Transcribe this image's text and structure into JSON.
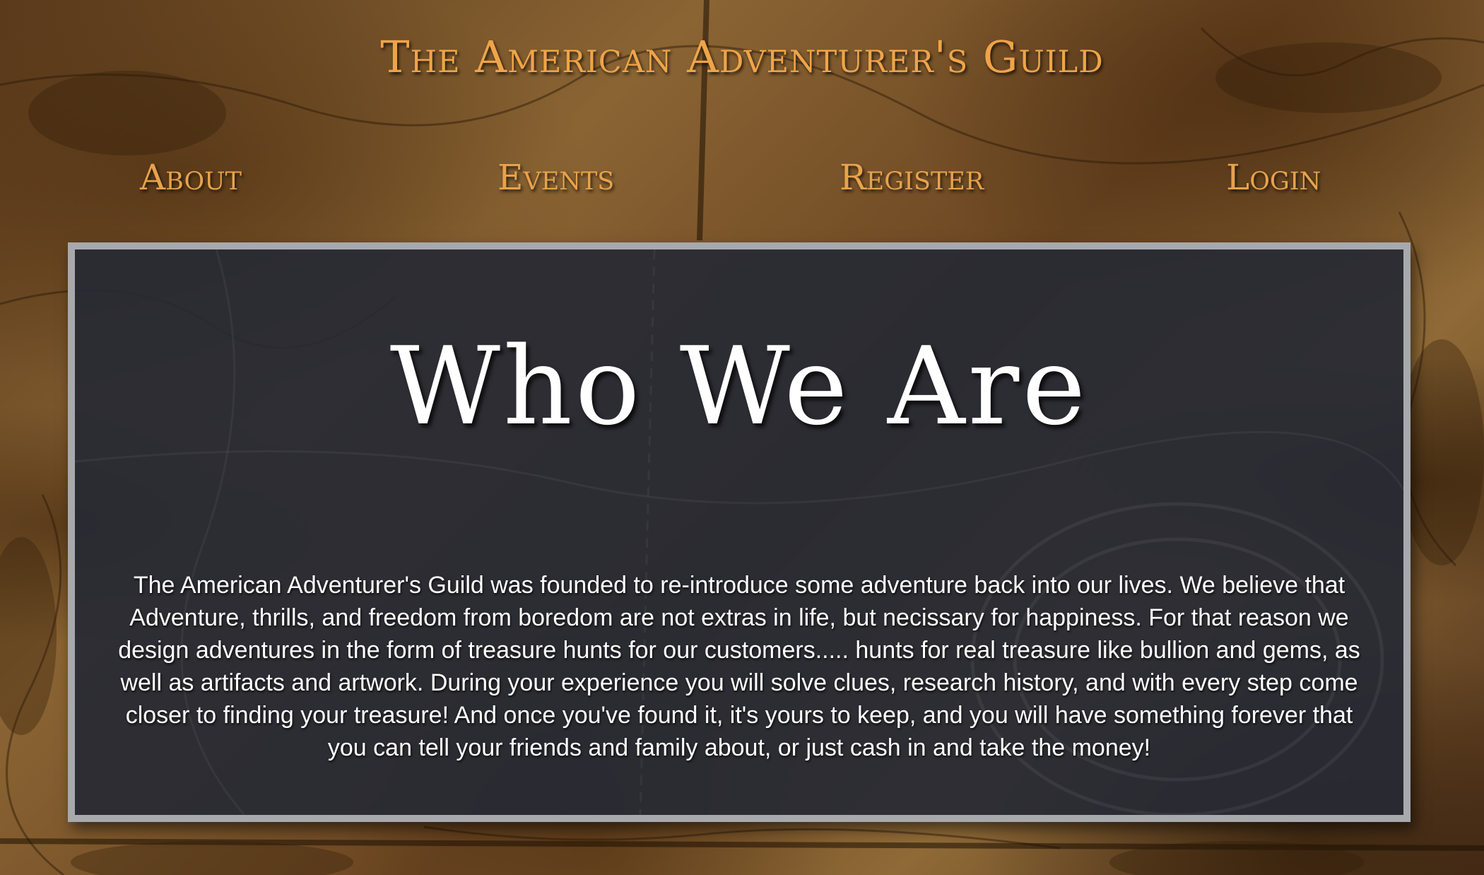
{
  "header": {
    "title": "The American Adventurer's Guild"
  },
  "nav": {
    "items": [
      {
        "label": "About"
      },
      {
        "label": "Events"
      },
      {
        "label": "Register"
      },
      {
        "label": "Login"
      }
    ]
  },
  "main": {
    "heading": "Who We Are",
    "body": "The American Adventurer's Guild was founded to re-introduce some adventure back into our lives. We believe that Adventure, thrills, and freedom from boredom are not extras in life, but necissary for happiness. For that reason we design adventures in the form of treasure hunts for our customers..... hunts for real treasure like bullion and gems, as well as artifacts and artwork. During your experience you will solve clues, research history, and with every step come closer to finding your treasure! And once you've found it, it's yours to keep, and you will have something forever that you can tell your friends and family about, or just cash in and take the money!"
  },
  "colors": {
    "title": "#f0a448",
    "nav": "#e8a24c",
    "panel_bg": "#262934",
    "panel_border": "#a7a9ad",
    "text": "#ffffff"
  }
}
